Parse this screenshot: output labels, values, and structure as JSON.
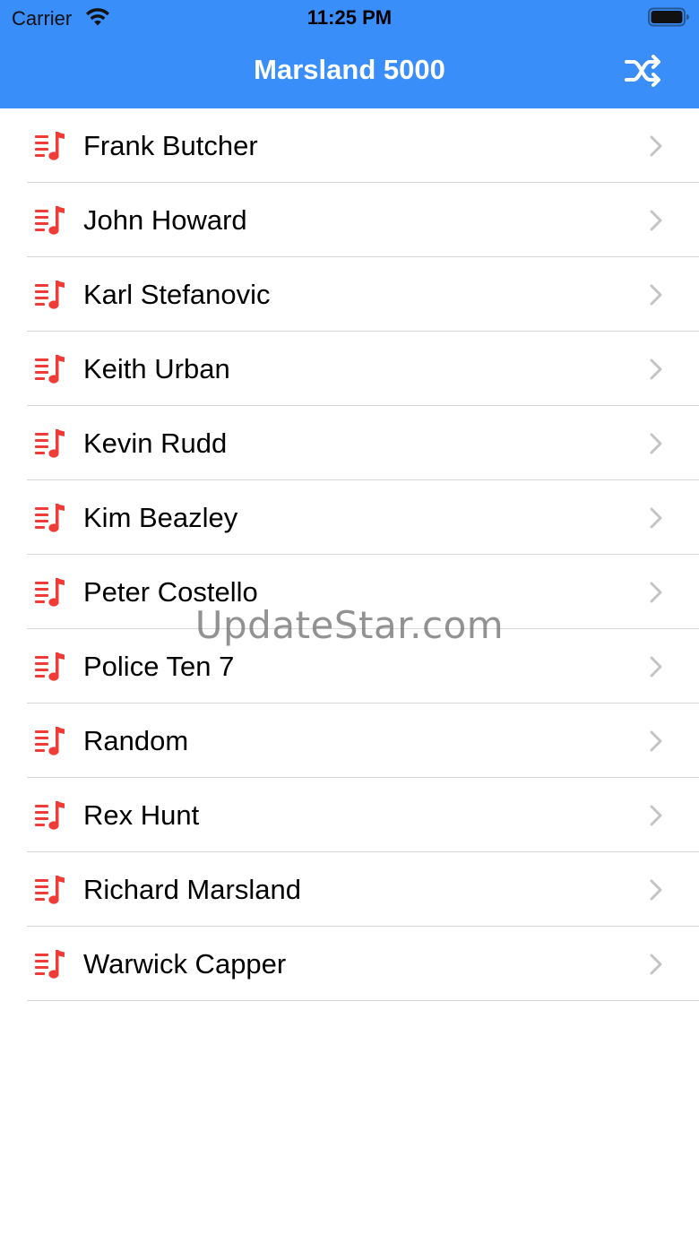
{
  "status_bar": {
    "carrier": "Carrier",
    "time": "11:25 PM"
  },
  "nav": {
    "title": "Marsland 5000",
    "shuffle_icon": "shuffle-icon"
  },
  "colors": {
    "header_bg": "#3a8efa",
    "icon_red": "#f13b36",
    "chevron": "#c4c4c7",
    "divider": "#d6d6da"
  },
  "items": [
    {
      "label": "Frank Butcher"
    },
    {
      "label": "John Howard"
    },
    {
      "label": "Karl Stefanovic"
    },
    {
      "label": "Keith Urban"
    },
    {
      "label": "Kevin Rudd"
    },
    {
      "label": "Kim Beazley"
    },
    {
      "label": "Peter Costello"
    },
    {
      "label": "Police Ten 7"
    },
    {
      "label": "Random"
    },
    {
      "label": "Rex Hunt"
    },
    {
      "label": "Richard Marsland"
    },
    {
      "label": "Warwick Capper"
    }
  ],
  "watermark": "UpdateStar.com"
}
